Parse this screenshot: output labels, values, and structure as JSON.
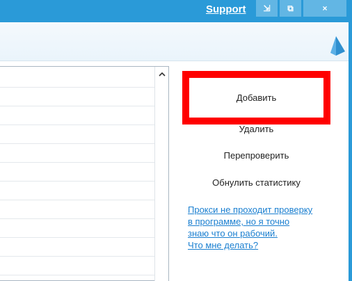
{
  "titlebar": {
    "support_label": "Support",
    "buttons": {
      "restore_1": "⇲",
      "restore_2": "⧉",
      "close": "×"
    }
  },
  "list": {
    "row_count": 11
  },
  "actions": {
    "add_label": "Добавить",
    "delete_label": "Удалить",
    "recheck_label": "Перепроверить",
    "reset_stats_label": "Обнулить статистику"
  },
  "help": {
    "line1": "Прокси не проходит проверку",
    "line2": "в программе, но я точно",
    "line3": "знаю что он рабочий.",
    "line4": "Что мне делать?"
  },
  "colors": {
    "accent": "#2a9ad8",
    "highlight": "#ff0000",
    "link": "#1a7fd0"
  }
}
